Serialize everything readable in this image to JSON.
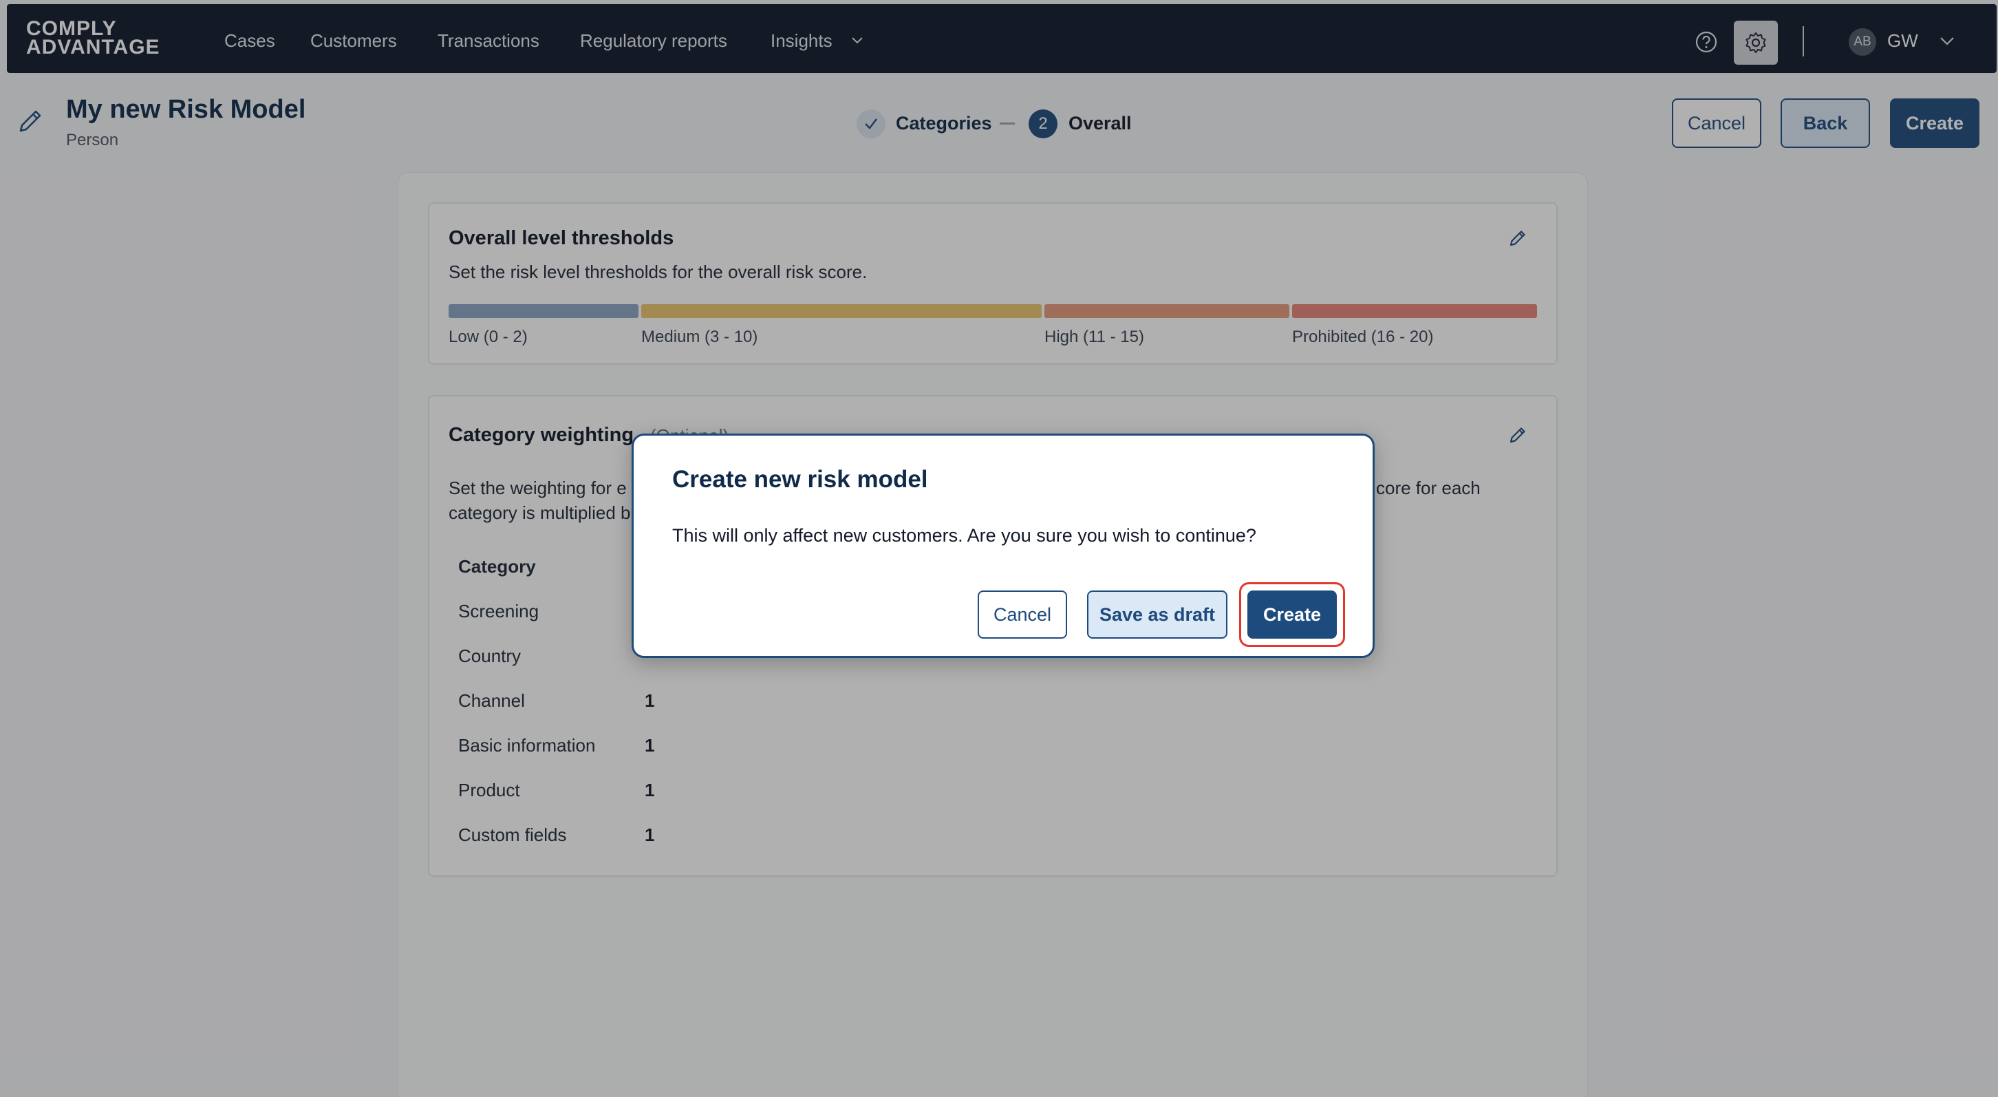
{
  "nav": {
    "logo_line1": "COMPLY",
    "logo_line2": "ADVANTAGE",
    "links": [
      "Cases",
      "Customers",
      "Transactions",
      "Regulatory reports",
      "Insights"
    ],
    "user_initials": "AB",
    "user_name": "GW"
  },
  "header": {
    "title": "My new Risk Model",
    "subtitle": "Person",
    "steps": [
      {
        "label": "Categories",
        "state": "complete"
      },
      {
        "number": "2",
        "label": "Overall",
        "state": "active"
      }
    ],
    "cancel_label": "Cancel",
    "back_label": "Back",
    "create_label": "Create"
  },
  "thresholds": {
    "title": "Overall level thresholds",
    "description": "Set the risk level thresholds for the overall risk score.",
    "levels": [
      {
        "label": "Low (0 - 2)",
        "color": "#8ba3c4"
      },
      {
        "label": "Medium (3 - 10)",
        "color": "#eac56d"
      },
      {
        "label": "High (11 - 15)",
        "color": "#e59a7d"
      },
      {
        "label": "Prohibited (16 - 20)",
        "color": "#e8837b"
      }
    ]
  },
  "weighting": {
    "title": "Category weighting",
    "title_suffix": "(Optional)",
    "description_line1": "Set the weighting for each category. The risk score for each",
    "description_line1_left": "Set the weighting for e",
    "description_line1_right": "core for each",
    "description_line2_left": "category is multiplied b",
    "column_header": "Category",
    "rows": [
      {
        "category": "Screening",
        "value": ""
      },
      {
        "category": "Country",
        "value": ""
      },
      {
        "category": "Channel",
        "value": "1"
      },
      {
        "category": "Basic information",
        "value": "1"
      },
      {
        "category": "Product",
        "value": "1"
      },
      {
        "category": "Custom fields",
        "value": "1"
      }
    ]
  },
  "modal": {
    "title": "Create new risk model",
    "message": "This will only affect new customers. Are you sure you wish to continue?",
    "cancel_label": "Cancel",
    "draft_label": "Save as draft",
    "create_label": "Create"
  },
  "colors": {
    "nav_bg": "#0f1a2c",
    "primary": "#1e4b7d",
    "highlight": "#e5362b"
  }
}
